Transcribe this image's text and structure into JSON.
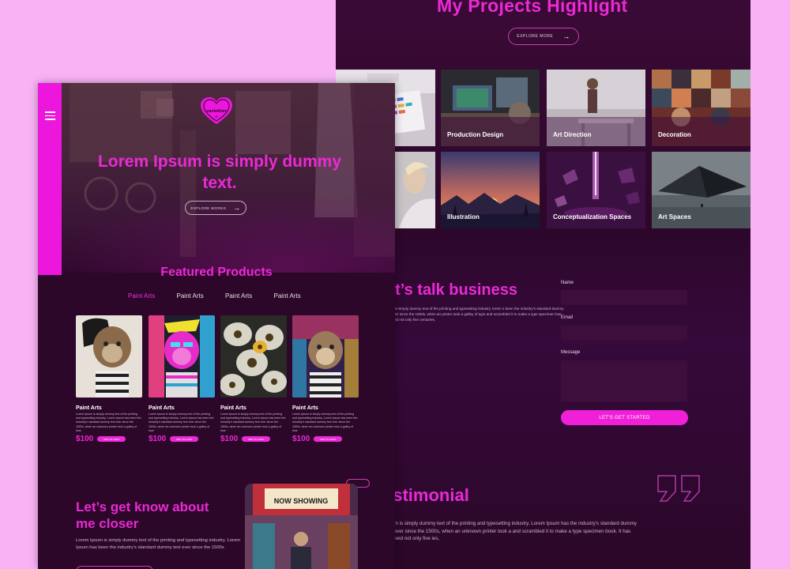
{
  "back": {
    "projects_title": "My Projects Highlight",
    "explore_more": "EXPLORE MORE",
    "tiles": [
      {
        "label": "Production Design"
      },
      {
        "label": "Art Direction"
      },
      {
        "label": "Decoration"
      },
      {
        "label": "Illustration"
      },
      {
        "label": "Conceptualization Spaces"
      },
      {
        "label": "Art Spaces"
      }
    ],
    "talk_title": "et’s talk business",
    "talk_text": "psum is simply dummy text of the printing and typesetting industry. lorem s been the industry's standard dummy text ever since the 1500s, when an printer took a galley of type and scrambled it to make a type specimen has survived not only five centuries,",
    "form": {
      "name_label": "Name",
      "email_label": "Email",
      "message_label": "Message",
      "submit": "LET'S GET STARTED"
    },
    "testimonial_title": "estimonial",
    "testimonial_text": "Ipsum is simply dummy text of the printing and typesetting industry. Lorem Ipsum has the industry's standard dummy text ever since the 1500s, when an unknown printer took a and scrambled it to make a type specimen book. It has survived not only five ies,"
  },
  "front": {
    "logo_text": "vanlekher",
    "hero_title": "Lorem Ipsum is simply dummy text.",
    "explore_works": "EXPLORE WORKS",
    "featured_title": "Featured Products",
    "tabs": [
      "Paint Arts",
      "Paint Arts",
      "Paint Arts",
      "Paint Arts"
    ],
    "products": [
      {
        "title": "Paint Arts",
        "desc": "Lorem Ipsum is simply dummy text of the printing and typesetting industry. Lorem Ipsum has been the industry's standard dummy text ever since the 1500s, when an unknown printer took a galley of type",
        "price": "$100",
        "button": "ADD TO CART"
      },
      {
        "title": "Paint Arts",
        "desc": "Lorem Ipsum is simply dummy text of the printing and typesetting industry. Lorem Ipsum has been the industry's standard dummy text ever since the 1500s, when an unknown printer took a galley of type",
        "price": "$100",
        "button": "ADD TO CART"
      },
      {
        "title": "Paint Arts",
        "desc": "Lorem Ipsum is simply dummy text of the printing and typesetting industry. Lorem Ipsum has been the industry's standard dummy text ever since the 1500s, when an unknown printer took a galley of type",
        "price": "$100",
        "button": "ADD TO CART"
      },
      {
        "title": "Paint Arts",
        "desc": "Lorem Ipsum is simply dummy text of the printing and typesetting industry. Lorem Ipsum has been the industry's standard dummy text ever since the 1500s, when an unknown printer took a galley of type",
        "price": "$100",
        "button": "ADD TO CART"
      }
    ],
    "about_title": "Let’s get know about me closer",
    "about_text": "Lorem Ipsum is simply dummy text of the printing and typesetting industry. Lorem Ipsum has been the industry's standard dummy text ever since the 1500s",
    "sign_text": "NOW SHOWING"
  },
  "colors": {
    "accent": "#ec29d6",
    "page_bg": "#2c0729",
    "outer_bg": "#f9b3f5"
  }
}
